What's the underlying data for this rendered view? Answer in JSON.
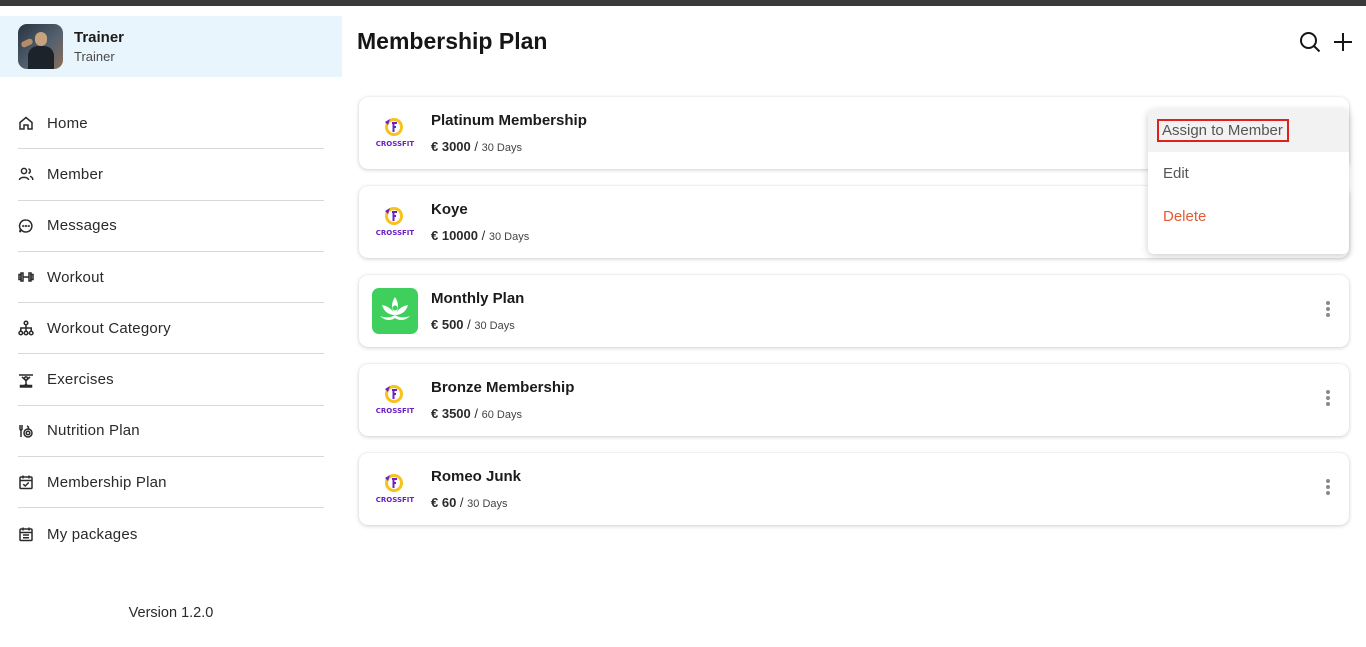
{
  "profile": {
    "name": "Trainer",
    "role": "Trainer"
  },
  "nav": {
    "items": [
      {
        "label": "Home",
        "icon": "home-icon"
      },
      {
        "label": "Member",
        "icon": "users-icon"
      },
      {
        "label": "Messages",
        "icon": "message-icon"
      },
      {
        "label": "Workout",
        "icon": "dumbbell-icon"
      },
      {
        "label": "Workout Category",
        "icon": "hierarchy-icon"
      },
      {
        "label": "Exercises",
        "icon": "exercise-icon"
      },
      {
        "label": "Nutrition Plan",
        "icon": "nutrition-icon"
      },
      {
        "label": "Membership Plan",
        "icon": "calendar-check-icon"
      },
      {
        "label": "My packages",
        "icon": "calendar-list-icon"
      }
    ]
  },
  "version": "Version 1.2.0",
  "header": {
    "title": "Membership Plan",
    "search_icon": "search-icon",
    "add_icon": "plus-icon"
  },
  "plans": [
    {
      "name": "Platinum Membership",
      "amount": "€ 3000",
      "duration": "30 Days",
      "logo": "crossfit-logo"
    },
    {
      "name": "Koye",
      "amount": "€ 10000",
      "duration": "30 Days",
      "logo": "crossfit-logo"
    },
    {
      "name": "Monthly Plan",
      "amount": "€ 500",
      "duration": "30 Days",
      "logo": "leaf-logo"
    },
    {
      "name": "Bronze Membership",
      "amount": "€ 3500",
      "duration": "60 Days",
      "logo": "crossfit-logo"
    },
    {
      "name": "Romeo Junk",
      "amount": "€ 60",
      "duration": "30 Days",
      "logo": "crossfit-logo"
    }
  ],
  "menu": {
    "assign": "Assign to Member",
    "edit": "Edit",
    "delete": "Delete"
  },
  "colors": {
    "profile_bg": "#e9f5fc",
    "delete": "#e55a33",
    "highlight_box": "#e0201b",
    "leaf_logo_bg": "#3ecf5c"
  },
  "logo_text": "CROSSFIT"
}
